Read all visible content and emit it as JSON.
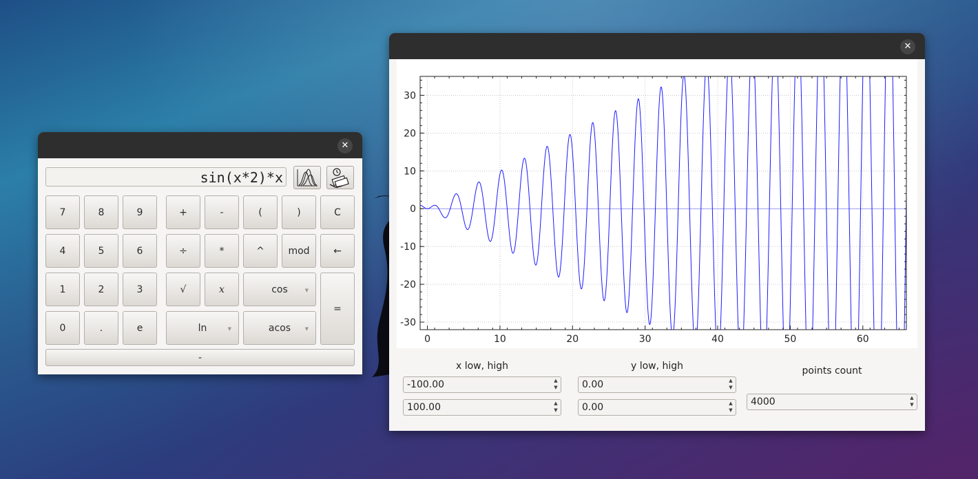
{
  "calculator": {
    "display": "sin(x*2)*x",
    "plot_button_icon": "function-plot-icon",
    "currency_button_icon": "currency-exchange-icon",
    "keys": {
      "k7": "7",
      "k8": "8",
      "k9": "9",
      "k4": "4",
      "k5": "5",
      "k6": "6",
      "k1": "1",
      "k2": "2",
      "k3": "3",
      "k0": "0",
      "kdot": ".",
      "ke": "e",
      "plus": "+",
      "minus": "-",
      "lparen": "(",
      "rparen": ")",
      "clear": "C",
      "divide": "÷",
      "multiply": "*",
      "power": "^",
      "mod": "mod",
      "backspace": "←",
      "sqrt": "√",
      "x": "x",
      "cos": "cos",
      "equals": "=",
      "ln": "ln",
      "acos": "acos",
      "bottom": "-"
    }
  },
  "plot_window": {
    "controls": {
      "x_label": "x low, high",
      "y_label": "y low, high",
      "points_label": "points count",
      "x_low": "-100.00",
      "x_high": "100.00",
      "y_low": "0.00",
      "y_high": "0.00",
      "points_count": "4000"
    }
  },
  "chart_data": {
    "type": "line",
    "function": "sin(x*2)*x",
    "xlim": [
      -1,
      66
    ],
    "ylim": [
      -32,
      35
    ],
    "x_ticks": [
      0,
      10,
      20,
      30,
      40,
      50,
      60
    ],
    "y_ticks": [
      30,
      20,
      10,
      0,
      -10,
      -20,
      -30
    ],
    "x_tick_labels": [
      "0",
      "10",
      "20",
      "30",
      "40",
      "50",
      "60"
    ],
    "y_tick_labels": [
      "30",
      "20",
      "10",
      "0",
      "-10",
      "-20",
      "-30"
    ],
    "grid": true,
    "line_color": "#1a1aff",
    "zero_line_color": "#8080ff"
  }
}
